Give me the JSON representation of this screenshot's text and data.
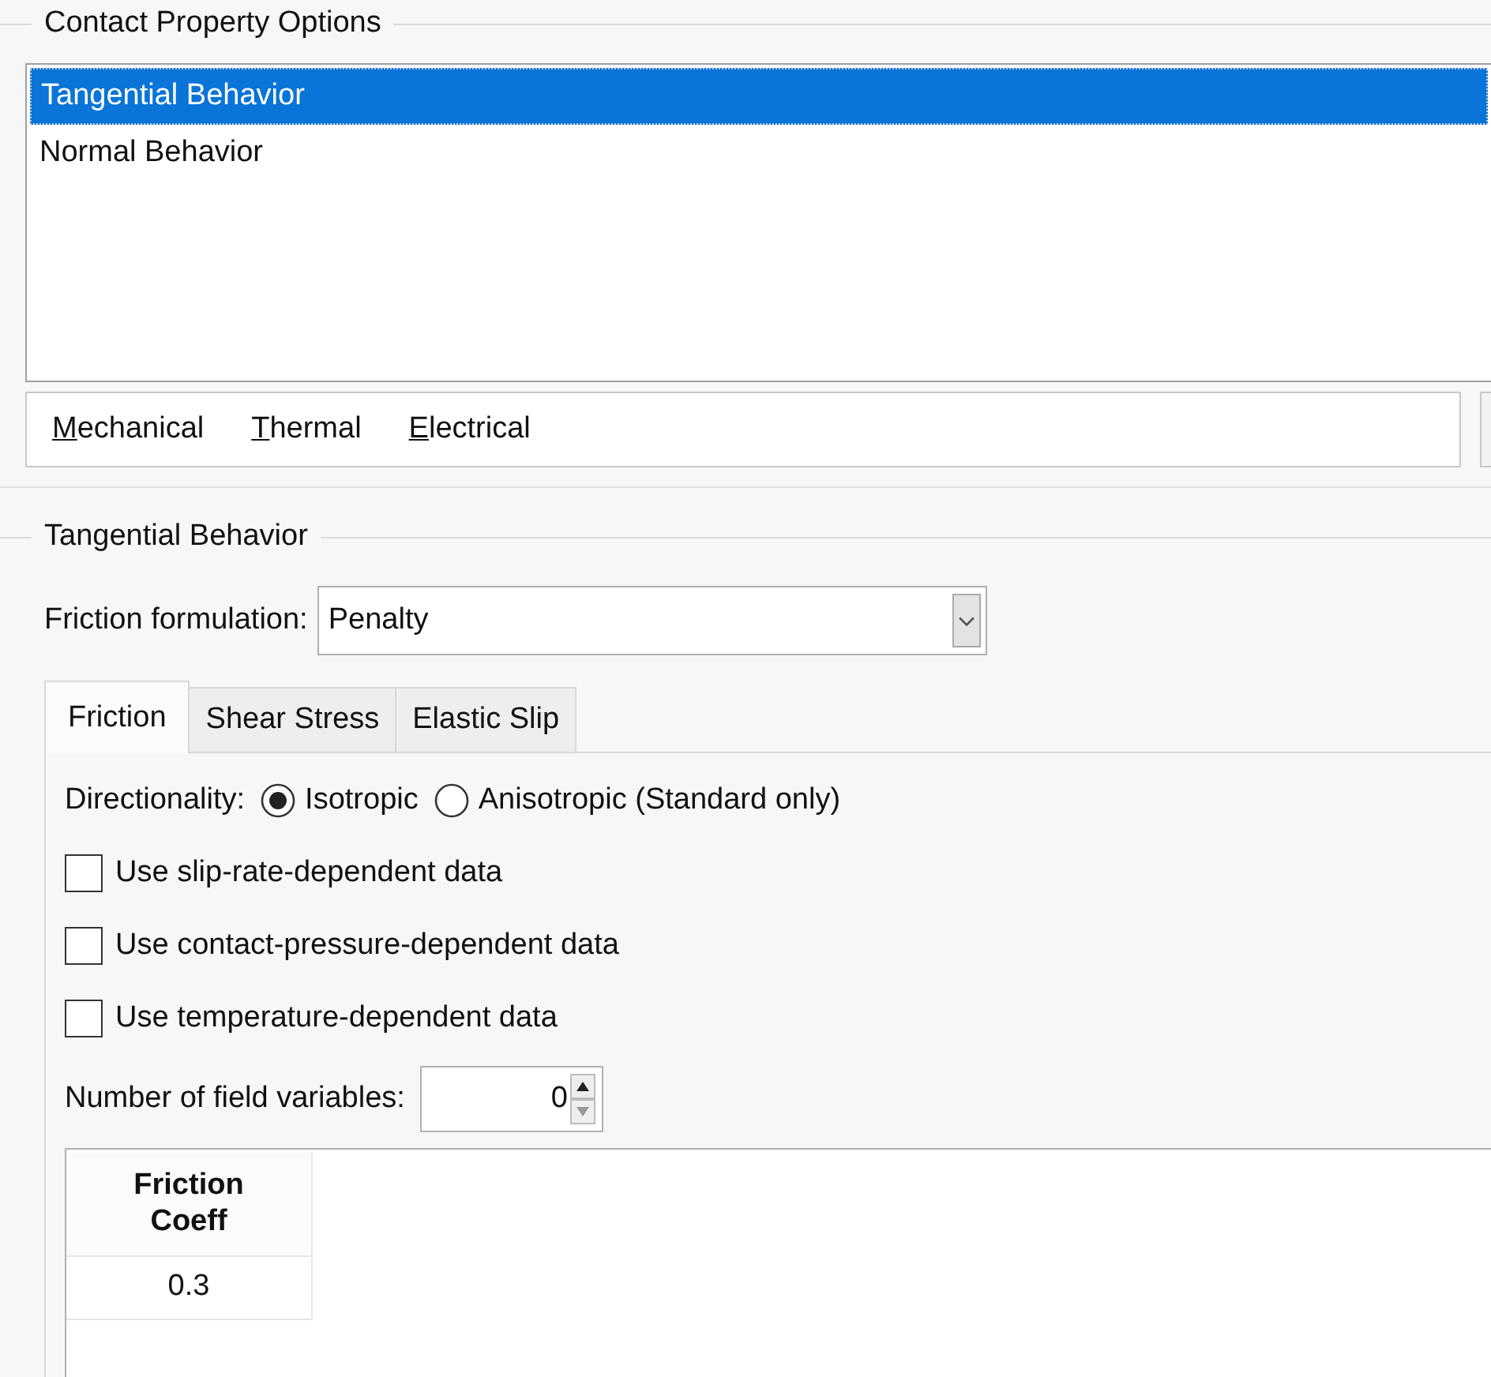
{
  "options_group": {
    "title": "Contact Property Options",
    "items": [
      {
        "label": "Tangential Behavior",
        "selected": true
      },
      {
        "label": "Normal Behavior",
        "selected": false
      }
    ],
    "menu": [
      "Mechanical",
      "Thermal",
      "Electrical"
    ]
  },
  "behavior_group": {
    "title": "Tangential Behavior",
    "formulation": {
      "label": "Friction formulation:",
      "value": "Penalty"
    },
    "tabs": [
      {
        "label": "Friction",
        "selected": true
      },
      {
        "label": "Shear Stress",
        "selected": false
      },
      {
        "label": "Elastic Slip",
        "selected": false
      }
    ],
    "directionality": {
      "label": "Directionality:",
      "options": [
        {
          "label": "Isotropic",
          "selected": true
        },
        {
          "label": "Anisotropic (Standard only)",
          "selected": false
        }
      ]
    },
    "checkboxes": [
      {
        "label": "Use slip-rate-dependent data",
        "checked": false
      },
      {
        "label": "Use contact-pressure-dependent data",
        "checked": false
      },
      {
        "label": "Use temperature-dependent data",
        "checked": false
      }
    ],
    "field_variables": {
      "label": "Number of field variables:",
      "value": "0"
    },
    "table": {
      "columns": [
        [
          "Friction",
          "Coeff"
        ]
      ],
      "rows": [
        [
          "0.3"
        ]
      ]
    }
  }
}
